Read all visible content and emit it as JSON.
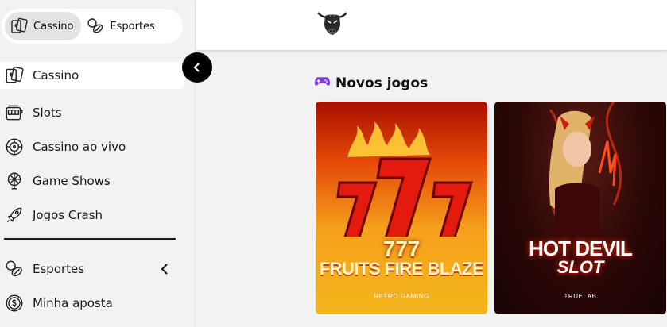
{
  "sidebar": {
    "switch": {
      "casino_label": "Cassino",
      "sports_label": "Esportes"
    },
    "items": [
      {
        "label": "Cassino",
        "icon": "cards-icon"
      },
      {
        "label": "Slots",
        "icon": "slot-machine-icon"
      },
      {
        "label": "Cassino ao vivo",
        "icon": "roulette-icon"
      },
      {
        "label": "Game Shows",
        "icon": "wheel-icon"
      },
      {
        "label": "Jogos Crash",
        "icon": "rocket-icon"
      }
    ],
    "items2": [
      {
        "label": "Esportes",
        "icon": "sports-balls-icon"
      },
      {
        "label": "Minha aposta",
        "icon": "coin-icon"
      }
    ]
  },
  "main": {
    "section_title": "Novos jogos",
    "section_icon": "gamepad-icon",
    "games": [
      {
        "title_line1": "777",
        "title_line2": "FRUITS FIRE BLAZE",
        "provider": "RETRO GAMING"
      },
      {
        "title_line1": "HOT DEVIL",
        "title_line2": "SLOT",
        "provider": "TRUELAB"
      }
    ]
  },
  "colors": {
    "accent": "#000000",
    "sidebar_bg": "#f2f2f2",
    "gamepad": "#7b3fd6"
  }
}
